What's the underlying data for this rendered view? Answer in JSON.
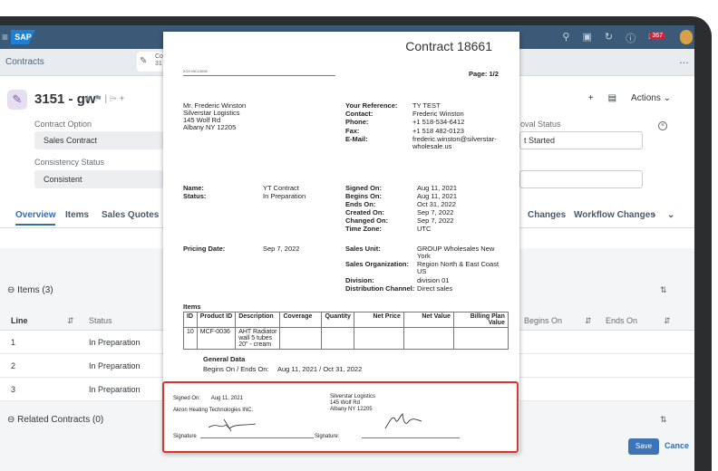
{
  "shell": {
    "logo": "SAP",
    "notifications": "367"
  },
  "breadcrumb": {
    "label": "Contracts",
    "tab_code_line1": "Co",
    "tab_code_line2": "31"
  },
  "header": {
    "title": "3151 - gw",
    "marks": "★ ⚑ | ⌲ +",
    "contract_option_label": "Contract Option",
    "contract_option_value": "Sales Contract",
    "consistency_label": "Consistency Status",
    "consistency_value": "Consistent",
    "approval_label": "oval Status",
    "approval_value": "t Started",
    "actions_label": "Actions"
  },
  "subtabs": {
    "overview": "Overview",
    "items": "Items",
    "sales_quotes": "Sales Quotes",
    "changes": "Changes",
    "workflow_changes": "Workflow Changes"
  },
  "items_section": {
    "title": "Items (3)",
    "columns": {
      "line": "Line",
      "status": "Status",
      "begins_on": "Begins On",
      "ends_on": "Ends On"
    },
    "rows": [
      {
        "line": "1",
        "status": "In Preparation"
      },
      {
        "line": "2",
        "status": "In Preparation"
      },
      {
        "line": "3",
        "status": "In Preparation"
      }
    ]
  },
  "related_section": {
    "title": "Related Contracts (0)"
  },
  "footer": {
    "save": "Save",
    "cancel": "Cance"
  },
  "document": {
    "title": "Contract  18661",
    "code": "ZCH MC10006",
    "page": "Page:  1/2",
    "address": {
      "name": "Mr. Frederic Winston",
      "company": "Silverstar Logistics",
      "street": "145 Wolf Rd",
      "city": "Albany NY  12205"
    },
    "contact_block": {
      "your_reference_label": "Your Reference:",
      "your_reference": "TY TEST",
      "contact_label": "Contact:",
      "contact": "Frederic Winston",
      "phone_label": "Phone:",
      "phone": "+1 518-534-6412",
      "fax_label": "Fax:",
      "fax": "+1 518 482-0123",
      "email_label": "E-Mail:",
      "email_line1": "frederic.winston@silverstar-",
      "email_line2": "wholesale.us"
    },
    "name_label": "Name:",
    "name_value": "YT Contract",
    "status_label": "Status:",
    "status_value": "In Preparation",
    "dates": {
      "signed_on_label": "Signed On:",
      "signed_on": "Aug 11, 2021",
      "begins_on_label": "Begins On:",
      "begins_on": "Aug 11, 2021",
      "ends_on_label": "Ends On:",
      "ends_on": "Oct 31, 2022",
      "created_on_label": "Created On:",
      "created_on": "Sep 7, 2022",
      "changed_on_label": "Changed On:",
      "changed_on": "Sep 7, 2022",
      "time_zone_label": "Time Zone:",
      "time_zone": "UTC"
    },
    "pricing_date_label": "Pricing Date:",
    "pricing_date": "Sep 7, 2022",
    "org": {
      "sales_unit_label": "Sales Unit:",
      "sales_unit_line1": "GROUP Wholesales New",
      "sales_unit_line2": "York",
      "sales_org_label": "Sales Organization:",
      "sales_org_line1": "Region North & East Coast",
      "sales_org_line2": "US",
      "division_label": "Division:",
      "division": "division 01",
      "channel_label": "Distribution Channel:",
      "channel": "Direct sales"
    },
    "items_heading": "Items",
    "items_table": {
      "headers": [
        "ID",
        "Product ID",
        "Description",
        "Coverage",
        "Quantity",
        "Net Price",
        "Net Value",
        "Billing Plan Value"
      ],
      "row": {
        "id": "10",
        "product": "MCF-0036",
        "desc_line1": "AHT Radiator",
        "desc_line2": "wall 5 tubes",
        "desc_line3": "20\" - cream"
      }
    },
    "general_data": "General Data",
    "begins_ends_label": "Begins On / Ends On:",
    "begins_ends_value": "Aug 11, 2021  /  Oct 31, 2022",
    "signature": {
      "signed_on_label": "Signed On:",
      "signed_on": "Aug 11, 2021",
      "seller": "Akron Heating Technologies INC.",
      "buyer_company": "Silverstar Logistics",
      "buyer_street": "145 Wolf Rd",
      "buyer_city": "Albany NY  12205",
      "left_label": "Signature",
      "right_label": "Signature:"
    }
  }
}
